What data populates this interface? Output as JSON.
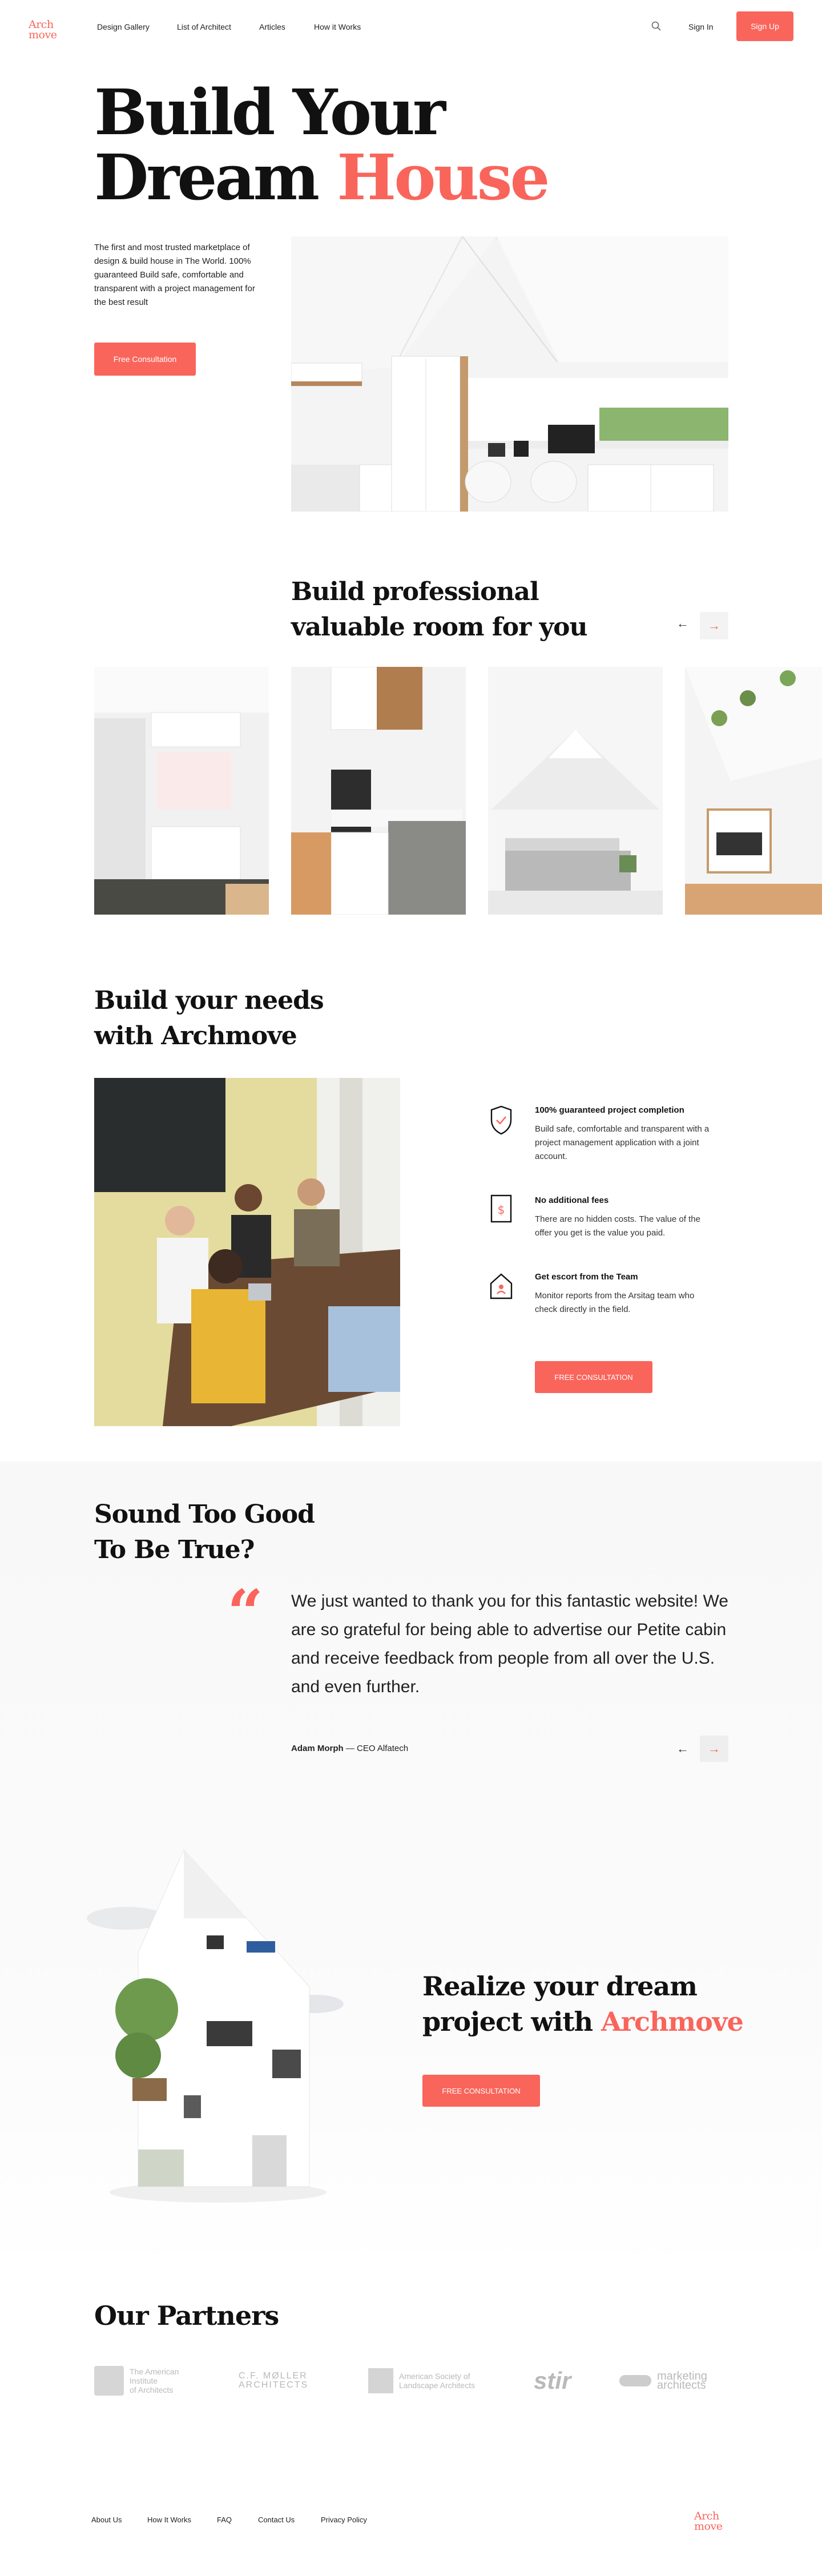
{
  "header": {
    "logo_line1": "Arch",
    "logo_line2": "move",
    "nav": [
      "Design Gallery",
      "List of Architect",
      "Articles",
      "How it Works"
    ],
    "search_icon": "search-icon",
    "signin_label": "Sign In",
    "signup_label": "Sign Up"
  },
  "hero": {
    "title_line1": "Build Your",
    "title_line2_plain": "Dream",
    "title_line2_accent": "House",
    "description": "The first and most trusted marketplace of design & build house in The World. 100% guaranteed Build safe, comfortable and transparent with a project management for the best result",
    "cta_label": "Free Consultation"
  },
  "rooms": {
    "title_line1": "Build professional",
    "title_line2": "valuable room for you",
    "prev_icon": "arrow-left-icon",
    "next_icon": "arrow-right-icon"
  },
  "needs": {
    "title_line1": "Build your needs",
    "title_line2": "with Archmove",
    "features": [
      {
        "title": "100% guaranteed project completion",
        "desc": "Build safe, comfortable and transparent with a project management application with a joint account.",
        "icon": "shield-check-icon"
      },
      {
        "title": "No additional fees",
        "desc": "There are no hidden costs. The value of the offer you get is the value you paid.",
        "icon": "dollar-document-icon"
      },
      {
        "title": "Get escort from the Team",
        "desc": "Monitor reports from the Arsitag team who check directly in the field.",
        "icon": "house-user-icon"
      }
    ],
    "cta_label": "FREE CONSULTATION"
  },
  "testimonial": {
    "title_line1": "Sound Too Good",
    "title_line2": "To Be True?",
    "quote": "We just wanted to thank you for this fantastic website! We are so grateful for being able to advertise our Petite cabin and receive feedback from people from all over the U.S. and even further.",
    "author_name": "Adam Morph",
    "author_role": " — CEO Alfatech"
  },
  "realize": {
    "title_line1": "Realize your dream",
    "title_line2_plain": "project with ",
    "title_line2_accent": "Archmove",
    "cta_label": "FREE CONSULTATION"
  },
  "partners": {
    "title": "Our Partners",
    "items": [
      {
        "line1": "The American",
        "line2": "Institute",
        "line3": "of Architects"
      },
      {
        "line1": "C.F. MØLLER",
        "line2": "ARCHITECTS"
      },
      {
        "line1": "American Society of",
        "line2": "Landscape Architects"
      },
      {
        "line1": "stir"
      },
      {
        "line1": "marketing",
        "line2": "architects"
      }
    ]
  },
  "footer": {
    "links": [
      "About Us",
      "How It Works",
      "FAQ",
      "Contact Us",
      "Privacy Policy"
    ],
    "logo_line1": "Arch",
    "logo_line2": "move"
  },
  "colors": {
    "accent": "#f9655b",
    "text": "#111111",
    "soft_bg": "#f8f8f8"
  }
}
